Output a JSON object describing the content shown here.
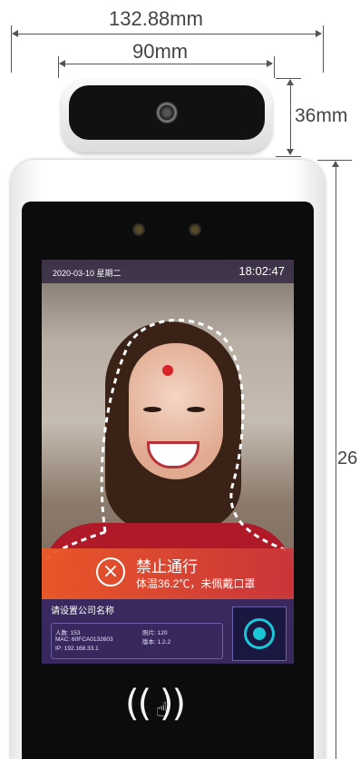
{
  "dimensions": {
    "total_width": "132.88mm",
    "camera_width": "90mm",
    "camera_height": "36mm",
    "body_height": "26"
  },
  "screen": {
    "date": "2020-03-10 星期二",
    "time": "18:02:47",
    "alert_title": "禁止通行",
    "alert_subtitle": "体温36.2℃，未佩戴口罩",
    "company_placeholder": "请设置公司名称",
    "info": {
      "people_label": "人数: 153",
      "photo_label": "照片: 120",
      "mac_label": "MAC: 60FCA0132603",
      "version_label": "版本: 1.2.2",
      "ip_label": "IP: 192.168.33.1"
    }
  },
  "nfc_symbol": "((    ))",
  "colors": {
    "alert": "#e85a30",
    "panel": "#342460",
    "accent": "#19c7d6"
  }
}
